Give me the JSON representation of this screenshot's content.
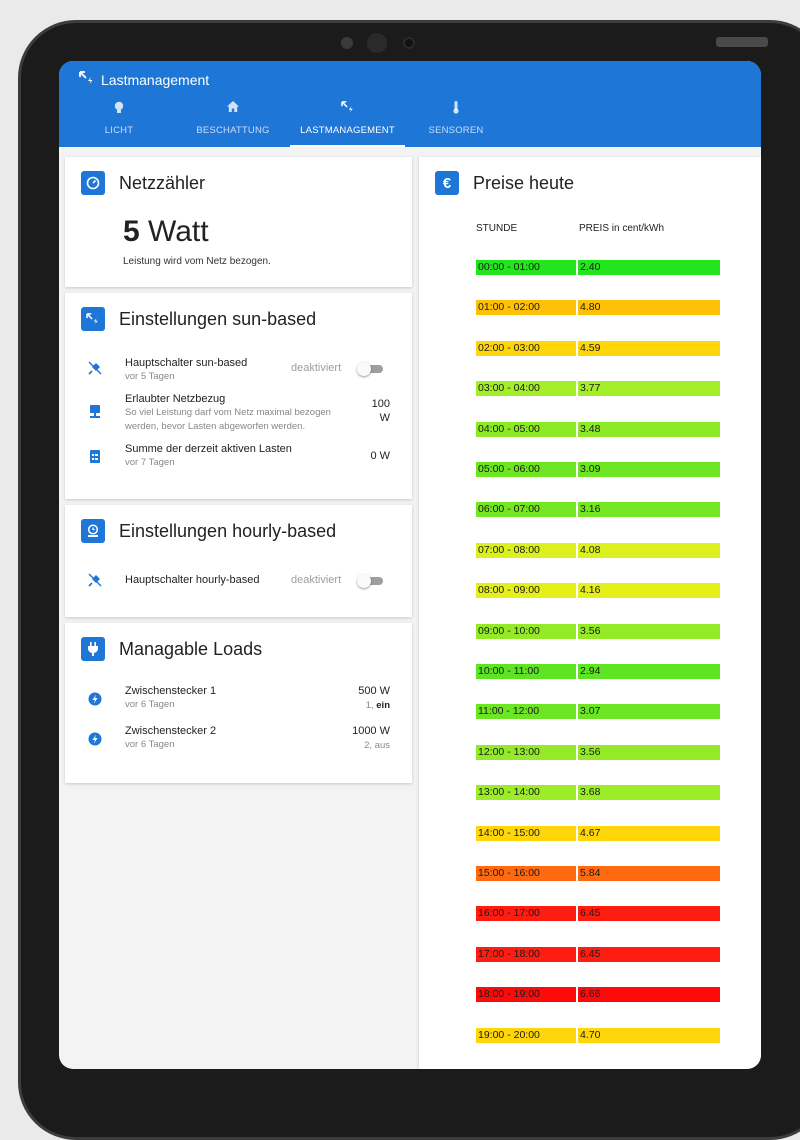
{
  "app": {
    "title": "Lastmanagement"
  },
  "tabs": [
    {
      "label": "LICHT",
      "icon": "lightbulb-icon"
    },
    {
      "label": "BESCHATTUNG",
      "icon": "home-icon"
    },
    {
      "label": "LASTMANAGEMENT",
      "icon": "load-management-icon",
      "active": true
    },
    {
      "label": "SENSOREN",
      "icon": "thermometer-icon"
    }
  ],
  "meter": {
    "title": "Netzzähler",
    "value": "5",
    "unit": "Watt",
    "subtitle": "Leistung wird vom Netz bezogen."
  },
  "sun_based": {
    "title": "Einstellungen sun-based",
    "rows": [
      {
        "label": "Hauptschalter sun-based",
        "sub": "vor 5 Tagen",
        "state": "deaktiviert"
      },
      {
        "label": "Erlaubter Netzbezug",
        "sub1": "So viel Leistung darf vom Netz maximal bezogen",
        "sub2": "werden, bevor Lasten abgeworfen werden.",
        "value1": "100",
        "value2": "W"
      },
      {
        "label": "Summe der derzeit aktiven Lasten",
        "sub": "vor 7 Tagen",
        "value": "0 W"
      }
    ]
  },
  "hourly_based": {
    "title": "Einstellungen hourly-based",
    "rows": [
      {
        "label": "Hauptschalter hourly-based",
        "state": "deaktiviert"
      }
    ]
  },
  "loads": {
    "title": "Managable Loads",
    "items": [
      {
        "label": "Zwischenstecker 1",
        "sub": "vor 6 Tagen",
        "power": "500 W",
        "prio": "1, ",
        "status": "ein"
      },
      {
        "label": "Zwischenstecker 2",
        "sub": "vor 6 Tagen",
        "power": "1000 W",
        "prio": "2, ",
        "status": "aus"
      }
    ]
  },
  "prices": {
    "title": "Preise heute",
    "col_hour": "STUNDE",
    "col_price": "PREIS in cent/kWh",
    "rows": [
      {
        "hour": "00:00 - 01:00",
        "price": "2.40",
        "color": "#22e51e"
      },
      {
        "hour": "01:00 - 02:00",
        "price": "4.80",
        "color": "#ffc107"
      },
      {
        "hour": "02:00 - 03:00",
        "price": "4.59",
        "color": "#ffd60a"
      },
      {
        "hour": "03:00 - 04:00",
        "price": "3.77",
        "color": "#a4ee2a"
      },
      {
        "hour": "04:00 - 05:00",
        "price": "3.48",
        "color": "#8cea25"
      },
      {
        "hour": "05:00 - 06:00",
        "price": "3.09",
        "color": "#6ee522"
      },
      {
        "hour": "06:00 - 07:00",
        "price": "3.16",
        "color": "#74e622"
      },
      {
        "hour": "07:00 - 08:00",
        "price": "4.08",
        "color": "#dcf01c"
      },
      {
        "hour": "08:00 - 09:00",
        "price": "4.16",
        "color": "#e4f018"
      },
      {
        "hour": "09:00 - 10:00",
        "price": "3.56",
        "color": "#94ea26"
      },
      {
        "hour": "10:00 - 11:00",
        "price": "2.94",
        "color": "#5ee422"
      },
      {
        "hour": "11:00 - 12:00",
        "price": "3.07",
        "color": "#6ce522"
      },
      {
        "hour": "12:00 - 13:00",
        "price": "3.56",
        "color": "#94ea26"
      },
      {
        "hour": "13:00 - 14:00",
        "price": "3.68",
        "color": "#9cec28"
      },
      {
        "hour": "14:00 - 15:00",
        "price": "4.67",
        "color": "#ffd60a"
      },
      {
        "hour": "15:00 - 16:00",
        "price": "5.84",
        "color": "#ff6a10"
      },
      {
        "hour": "16:00 - 17:00",
        "price": "6.45",
        "color": "#ff1c10"
      },
      {
        "hour": "17:00 - 18:00",
        "price": "6.45",
        "color": "#ff1c10"
      },
      {
        "hour": "18:00 - 19:00",
        "price": "6.66",
        "color": "#ff0a0a"
      },
      {
        "hour": "19:00 - 20:00",
        "price": "4.70",
        "color": "#ffd60a"
      }
    ]
  }
}
